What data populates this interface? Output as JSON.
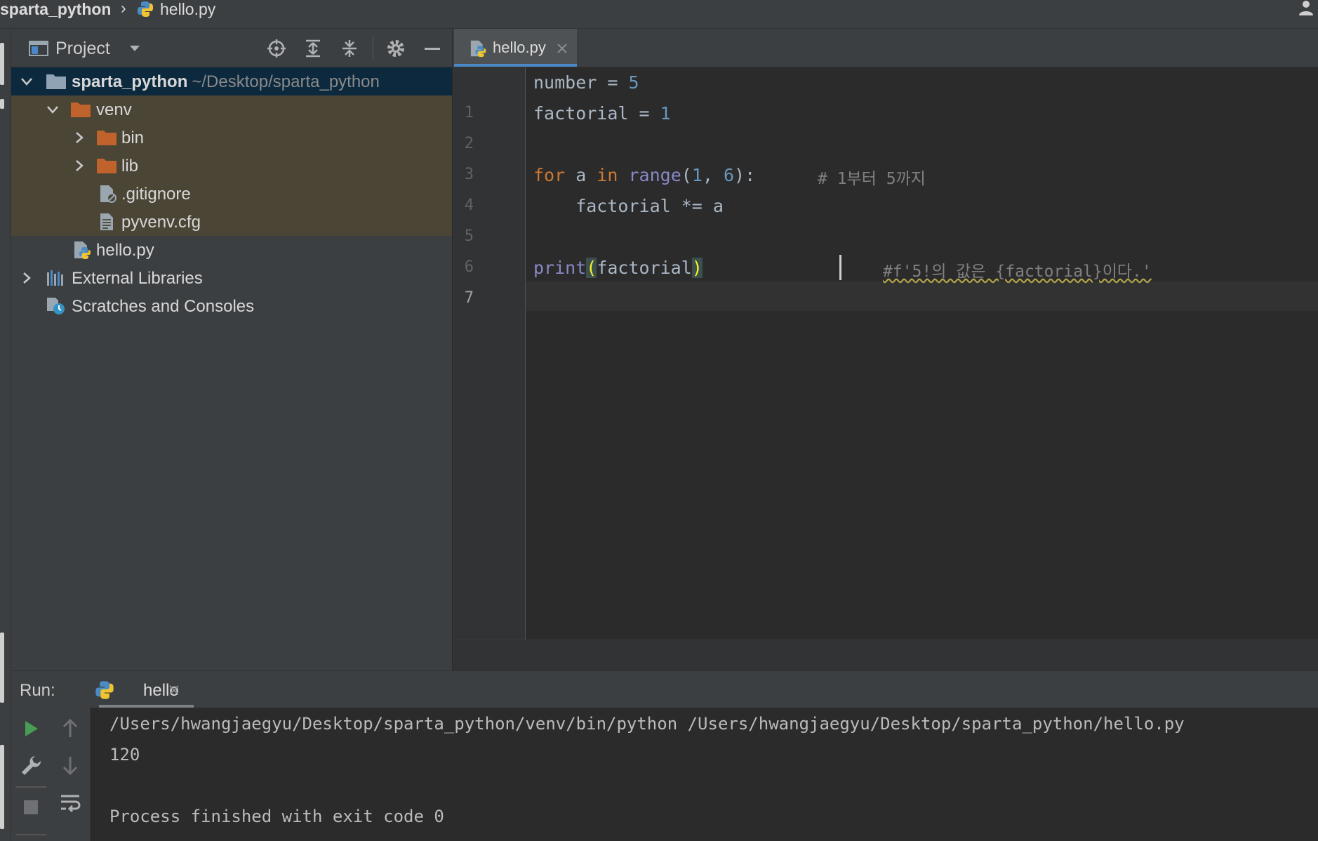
{
  "breadcrumb": {
    "project": "sparta_python",
    "separator": "›",
    "file": "hello.py"
  },
  "project_panel": {
    "title": "Project",
    "tree": [
      {
        "label": "sparta_python",
        "sub": "~/Desktop/sparta_python"
      },
      {
        "label": "venv"
      },
      {
        "label": "bin"
      },
      {
        "label": "lib"
      },
      {
        "label": ".gitignore"
      },
      {
        "label": "pyvenv.cfg"
      },
      {
        "label": "hello.py"
      },
      {
        "label": "External Libraries"
      },
      {
        "label": "Scratches and Consoles"
      }
    ]
  },
  "editor": {
    "tab_label": "hello.py",
    "line_numbers": [
      "1",
      "2",
      "3",
      "4",
      "5",
      "6",
      "7"
    ],
    "lines": {
      "l1": {
        "a": "number = ",
        "b": "5"
      },
      "l2": {
        "a": "factorial = ",
        "b": "1"
      },
      "l4": {
        "for": "for",
        "a": " a ",
        "in": "in",
        "sp": " ",
        "range": "range",
        "open": "(",
        "n1": "1",
        "comma": ", ",
        "n2": "6",
        "close": "):",
        "comment": "# 1부터 5까지"
      },
      "l5": {
        "text": "    factorial *= a"
      },
      "l7": {
        "print": "print",
        "open": "(",
        "arg": "factorial",
        "close": ")",
        "comment": "#f'5!의 값은 {factorial}이다.'"
      }
    }
  },
  "run_panel": {
    "label": "Run:",
    "tab_label": "hello",
    "output": [
      "/Users/hwangjaegyu/Desktop/sparta_python/venv/bin/python /Users/hwangjaegyu/Desktop/sparta_python/hello.py",
      "120",
      "",
      "Process finished with exit code 0"
    ]
  },
  "colors": {
    "keyword": "#cc7832",
    "number": "#6897bb",
    "builtin": "#8888c6",
    "comment": "#808080",
    "selection_bg": "#3b5070",
    "folder_orange": "#c0622c",
    "run_green": "#499c54"
  }
}
